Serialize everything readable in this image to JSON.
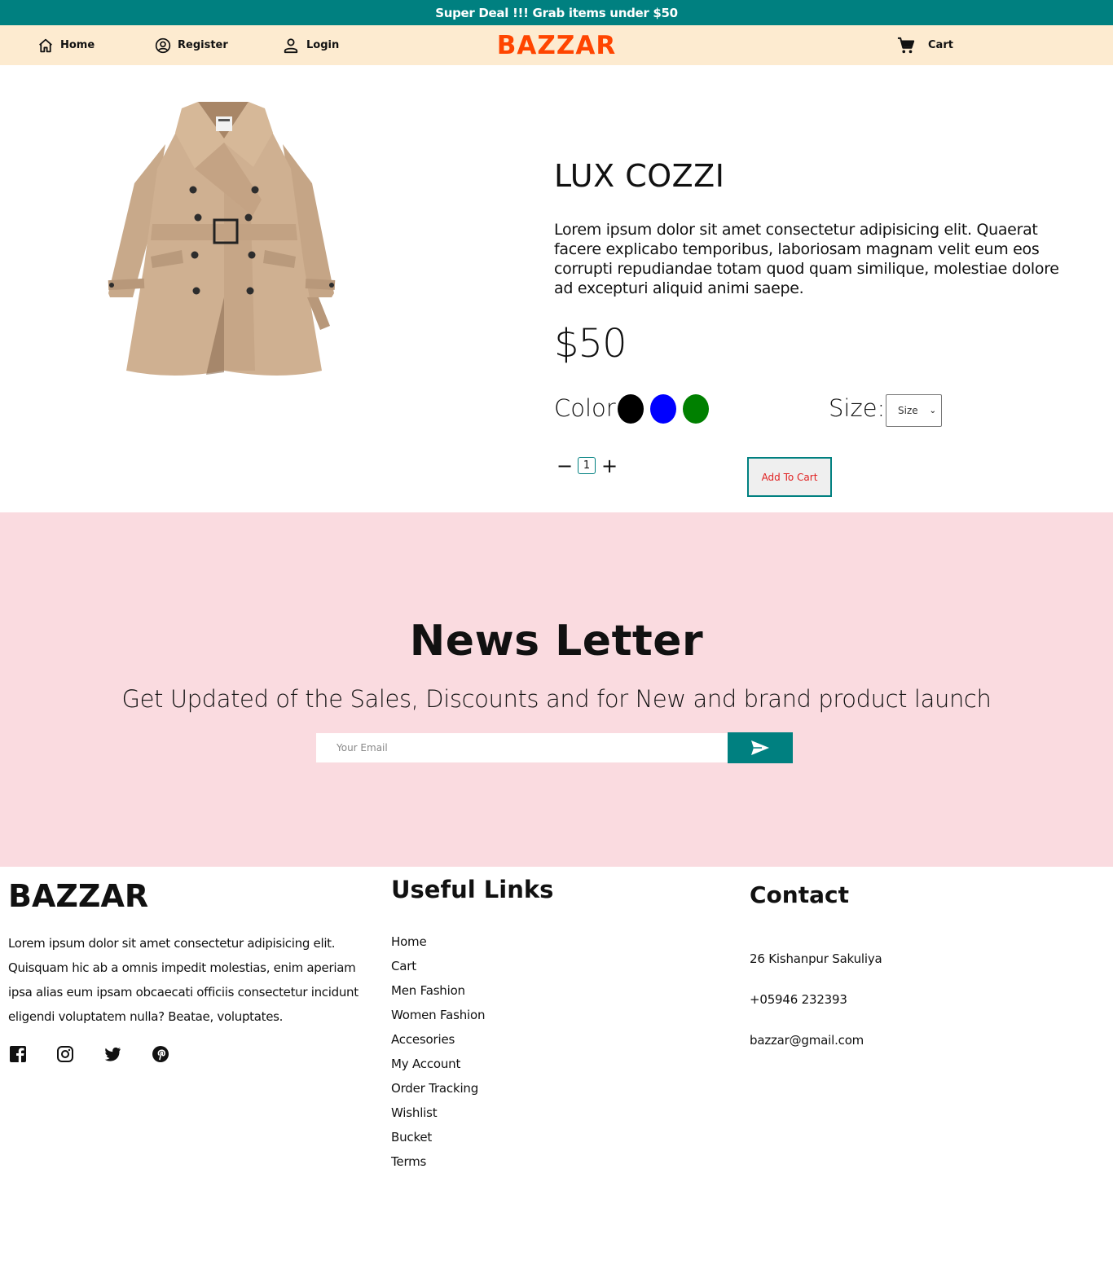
{
  "announcement": "Super Deal !!! Grab items under $50",
  "nav": {
    "home": "Home",
    "register": "Register",
    "login": "Login",
    "brand": "BAZZAR",
    "cart": "Cart"
  },
  "product": {
    "title": "LUX COZZI",
    "description": "Lorem ipsum dolor sit amet consectetur adipisicing elit. Quaerat facere explicabo temporibus, laboriosam magnam velit eum eos corrupti repudiandae totam quod quam similique, molestiae dolore ad excepturi aliquid animi saepe.",
    "price": "$50",
    "color_label": "Color",
    "colors": [
      "#000000",
      "#0000ff",
      "#008000"
    ],
    "size_label": "Size:",
    "size_select": "Size",
    "quantity": "1",
    "qty_minus": "−",
    "qty_plus": "+",
    "add_to_cart": "Add To Cart"
  },
  "newsletter": {
    "title": "News Letter",
    "subtitle": "Get Updated of the Sales, Discounts and for New and brand product launch",
    "email_placeholder": "Your Email"
  },
  "footer": {
    "brand": "BAZZAR",
    "about": "Lorem ipsum dolor sit amet consectetur adipisicing elit. Quisquam hic ab a omnis impedit molestias, enim aperiam ipsa alias eum ipsam obcaecati officiis consectetur incidunt eligendi voluptatem nulla? Beatae, voluptates.",
    "social": [
      "facebook-icon",
      "instagram-icon",
      "twitter-icon",
      "pinterest-icon"
    ],
    "links_title": "Useful Links",
    "links": [
      "Home",
      "Cart",
      "Men Fashion",
      "Women Fashion",
      "Accesories",
      "My Account",
      "Order Tracking",
      "Wishlist",
      "Bucket",
      "Terms"
    ],
    "contact_title": "Contact",
    "address": "26 Kishanpur Sakuliya",
    "phone": "+05946 232393",
    "email": "bazzar@gmail.com"
  },
  "colors": {
    "teal": "#008080",
    "nav_bg": "#fdebd0",
    "brand_orange": "#ff4500",
    "newsletter_bg": "#fadbe0",
    "add_to_cart_text": "#e02020"
  }
}
